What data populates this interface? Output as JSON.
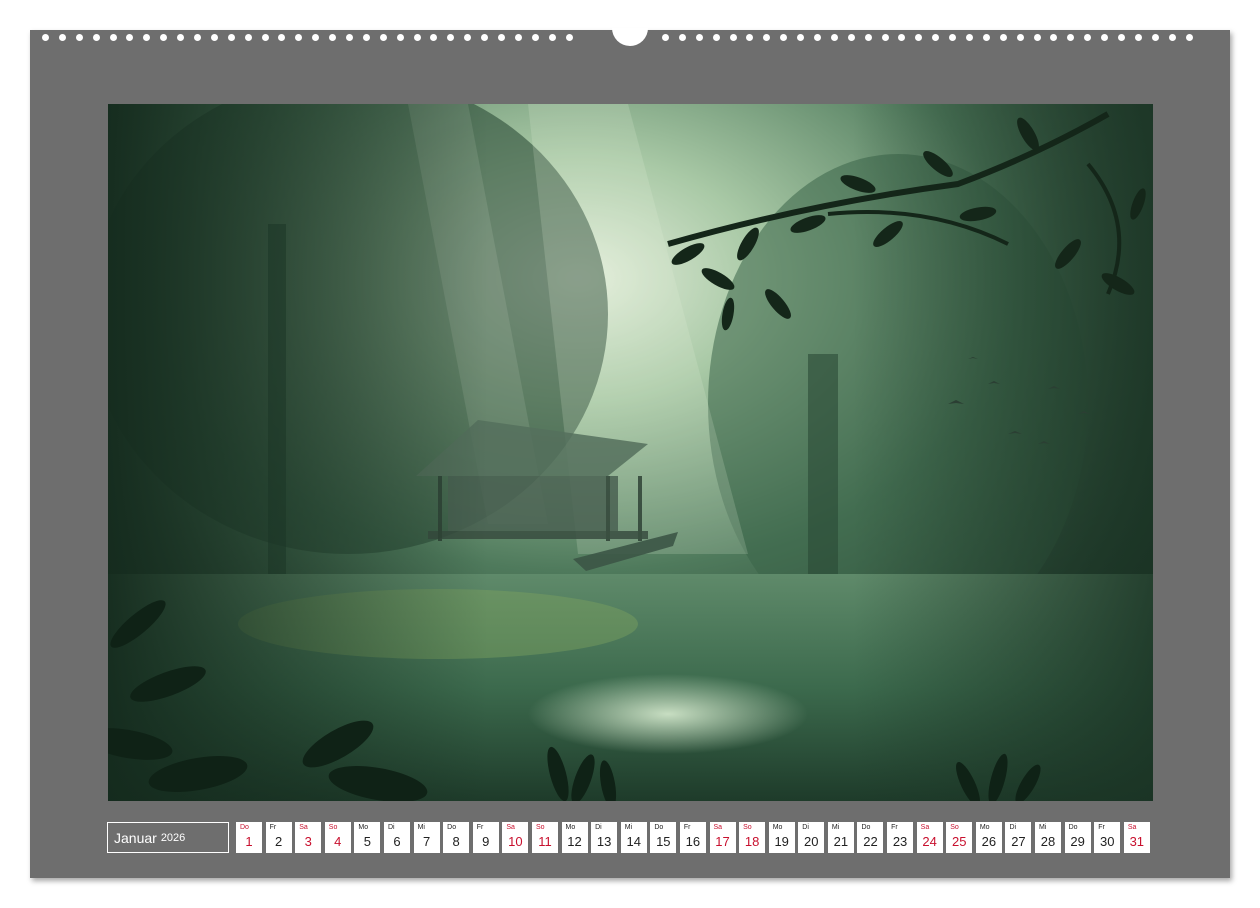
{
  "calendar": {
    "month": "Januar",
    "year": "2026",
    "days": [
      {
        "wd": "Do",
        "n": "1",
        "holiday": true
      },
      {
        "wd": "Fr",
        "n": "2",
        "holiday": false
      },
      {
        "wd": "Sa",
        "n": "3",
        "holiday": true
      },
      {
        "wd": "So",
        "n": "4",
        "holiday": true
      },
      {
        "wd": "Mo",
        "n": "5",
        "holiday": false
      },
      {
        "wd": "Di",
        "n": "6",
        "holiday": false
      },
      {
        "wd": "Mi",
        "n": "7",
        "holiday": false
      },
      {
        "wd": "Do",
        "n": "8",
        "holiday": false
      },
      {
        "wd": "Fr",
        "n": "9",
        "holiday": false
      },
      {
        "wd": "Sa",
        "n": "10",
        "holiday": true
      },
      {
        "wd": "So",
        "n": "11",
        "holiday": true
      },
      {
        "wd": "Mo",
        "n": "12",
        "holiday": false
      },
      {
        "wd": "Di",
        "n": "13",
        "holiday": false
      },
      {
        "wd": "Mi",
        "n": "14",
        "holiday": false
      },
      {
        "wd": "Do",
        "n": "15",
        "holiday": false
      },
      {
        "wd": "Fr",
        "n": "16",
        "holiday": false
      },
      {
        "wd": "Sa",
        "n": "17",
        "holiday": true
      },
      {
        "wd": "So",
        "n": "18",
        "holiday": true
      },
      {
        "wd": "Mo",
        "n": "19",
        "holiday": false
      },
      {
        "wd": "Di",
        "n": "20",
        "holiday": false
      },
      {
        "wd": "Mi",
        "n": "21",
        "holiday": false
      },
      {
        "wd": "Do",
        "n": "22",
        "holiday": false
      },
      {
        "wd": "Fr",
        "n": "23",
        "holiday": false
      },
      {
        "wd": "Sa",
        "n": "24",
        "holiday": true
      },
      {
        "wd": "So",
        "n": "25",
        "holiday": true
      },
      {
        "wd": "Mo",
        "n": "26",
        "holiday": false
      },
      {
        "wd": "Di",
        "n": "27",
        "holiday": false
      },
      {
        "wd": "Mi",
        "n": "28",
        "holiday": false
      },
      {
        "wd": "Do",
        "n": "29",
        "holiday": false
      },
      {
        "wd": "Fr",
        "n": "30",
        "holiday": false
      },
      {
        "wd": "Sa",
        "n": "31",
        "holiday": true
      }
    ]
  },
  "colors": {
    "frame": "#6e6e6e",
    "holiday_text": "#c8102e",
    "photo_mist": "#b8d6b8",
    "photo_dark": "#1c3326"
  },
  "photo": {
    "icon": "misty-swamp-hut-photo"
  }
}
